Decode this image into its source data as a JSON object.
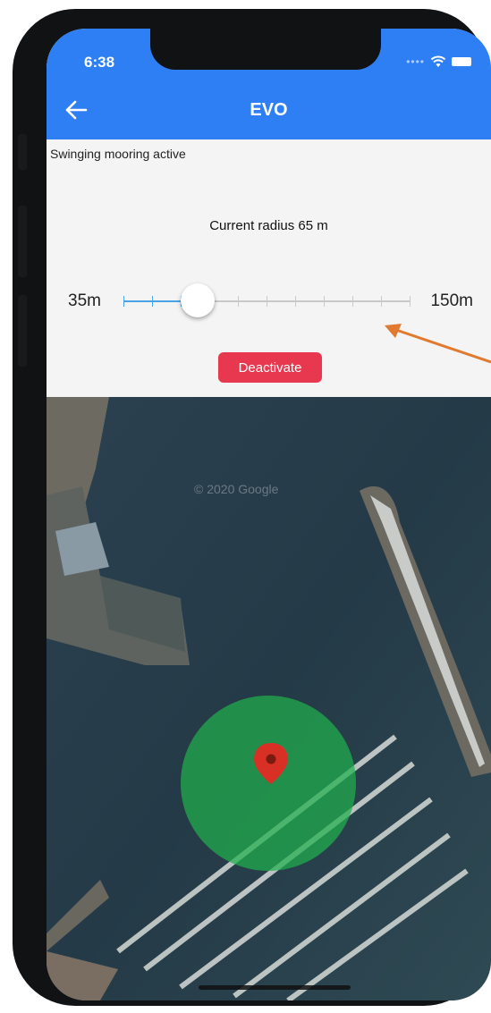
{
  "status_bar": {
    "time": "6:38"
  },
  "header": {
    "title": "EVO",
    "back_icon": "back-arrow-icon"
  },
  "mooring": {
    "status_text": "Swinging mooring active",
    "current_radius_text": "Current radius 65 m",
    "slider": {
      "min_label": "35m",
      "max_label": "150m",
      "min": 35,
      "max": 150,
      "value": 65,
      "ticks": 11
    },
    "deactivate_label": "Deactivate"
  },
  "map": {
    "watermark": "© 2020 Google",
    "marker_icon": "map-pin-icon"
  },
  "colors": {
    "header": "#2f7ff4",
    "slider_active": "#4aa3e6",
    "slider_inactive": "#c9c9c9",
    "button": "#e8384f",
    "radius_circle": "#20b04c",
    "marker": "#d93025",
    "annotation_arrow": "#e07a30"
  }
}
